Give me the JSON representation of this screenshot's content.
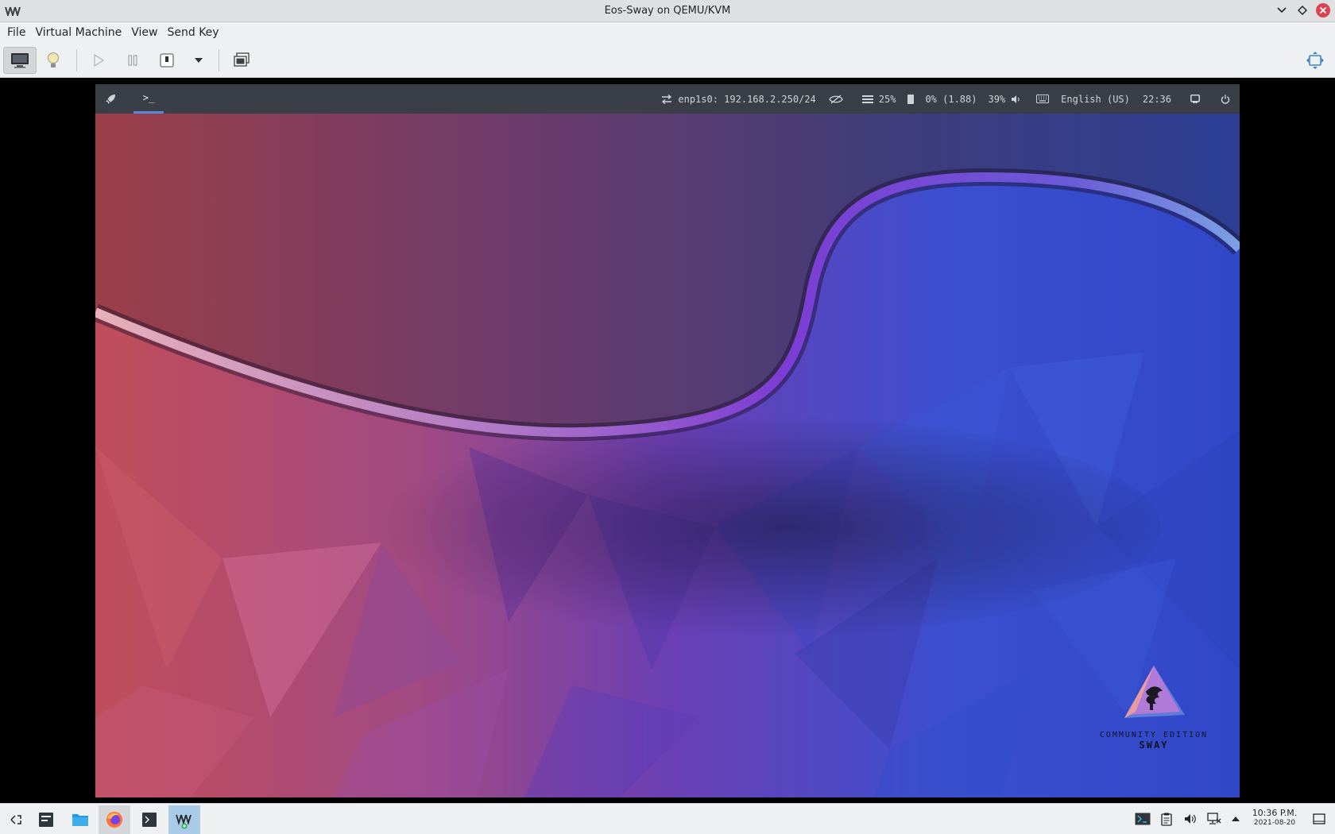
{
  "window": {
    "title": "Eos-Sway on QEMU/KVM",
    "controls": [
      "minimize-icon",
      "maximize-icon",
      "close-icon"
    ]
  },
  "menubar": {
    "items": [
      "File",
      "Virtual Machine",
      "View",
      "Send Key"
    ]
  },
  "toolbar": {
    "buttons": [
      "console-icon",
      "details-icon",
      "run-icon",
      "pause-icon",
      "shutdown-icon",
      "shutdown-menu-icon",
      "snapshots-icon",
      "fullscreen-icon"
    ]
  },
  "guest": {
    "waybar": {
      "launcher_icon": "rocket-icon",
      "workspace_label": ">_",
      "network": "enp1s0: 192.168.2.250/24",
      "memory": "25%",
      "cpu": "0% (1.88)",
      "volume": "39%",
      "keyboard_layout": "English (US)",
      "clock": "22:36"
    },
    "wallpaper": {
      "logo_line1": "COMMUNITY EDITION",
      "logo_line2": "SWAY",
      "colors": {
        "red": "#c14d5a",
        "pink": "#c5609a",
        "purple": "#6b3fb3",
        "blue": "#3b4fd0",
        "dark_blue": "#2a3aa8",
        "ribbon": "#7d3cd4"
      }
    }
  },
  "taskbar": {
    "apps": [
      "app-launcher-icon",
      "task-manager-icon",
      "file-manager-icon",
      "firefox-icon",
      "terminal-icon",
      "virt-manager-icon"
    ],
    "tray": [
      "terminal-tray-icon",
      "clipboard-icon",
      "volume-icon",
      "network-icon",
      "expand-tray-icon"
    ],
    "clock_time": "10:36 P.M.",
    "clock_date": "2021-08-20",
    "show_desktop": "show-desktop-icon"
  },
  "colors": {
    "titlebar_bg": "#dee0e2",
    "toolbar_bg": "#eff0f1",
    "waybar_bg": "#3a3f47",
    "close_red": "#da4453",
    "accent_blue": "#3daee9"
  }
}
